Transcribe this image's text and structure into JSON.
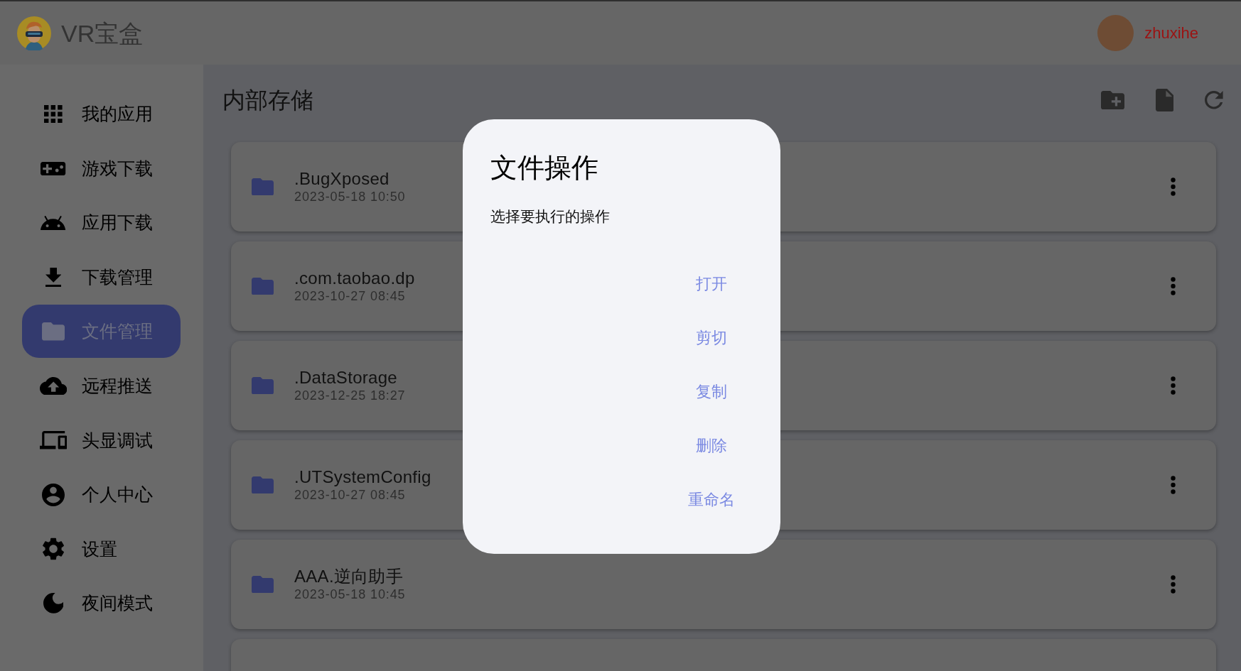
{
  "app_bar": {
    "title": "VR宝盒",
    "user": {
      "name": "zhuxihe"
    }
  },
  "sidebar": {
    "items": [
      {
        "label": "我的应用",
        "selected": false
      },
      {
        "label": "游戏下载",
        "selected": false
      },
      {
        "label": "应用下载",
        "selected": false
      },
      {
        "label": "下载管理",
        "selected": false
      },
      {
        "label": "文件管理",
        "selected": true
      },
      {
        "label": "远程推送",
        "selected": false
      },
      {
        "label": "头显调试",
        "selected": false
      },
      {
        "label": "个人中心",
        "selected": false
      },
      {
        "label": "设置",
        "selected": false
      },
      {
        "label": "夜间模式",
        "selected": false
      }
    ]
  },
  "storage": {
    "title": "内部存储",
    "files": [
      {
        "name": ".BugXposed",
        "modified": "2023-05-18 10:50"
      },
      {
        "name": ".com.taobao.dp",
        "modified": "2023-10-27 08:45"
      },
      {
        "name": ".DataStorage",
        "modified": "2023-12-25 18:27"
      },
      {
        "name": ".UTSystemConfig",
        "modified": "2023-10-27 08:45"
      },
      {
        "name": "AAA.逆向助手",
        "modified": "2023-05-18 10:45"
      }
    ]
  },
  "dialog": {
    "title": "文件操作",
    "message": "选择要执行的操作",
    "actions": [
      "打开",
      "剪切",
      "复制",
      "删除",
      "重命名"
    ]
  }
}
